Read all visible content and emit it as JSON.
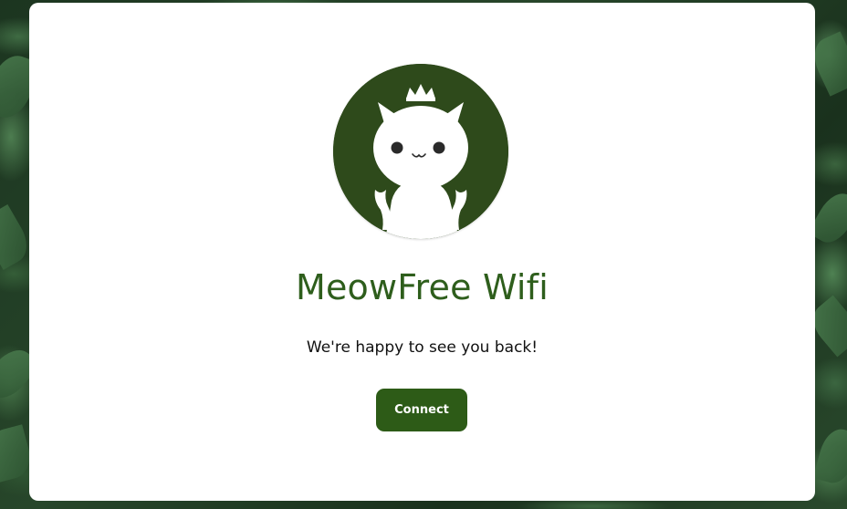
{
  "page": {
    "title": "MeowFree Wifi",
    "subtitle": "We're happy to see you back!",
    "connect_label": "Connect"
  },
  "logo": {
    "icon": "cat-with-crown-logo",
    "background_color": "#2e4a1b",
    "figure_color": "#ffffff"
  },
  "colors": {
    "title": "#2e5e1c",
    "button": "#2d5b17",
    "button_text": "#ffffff",
    "card": "#ffffff",
    "background": "#1f3a22"
  }
}
